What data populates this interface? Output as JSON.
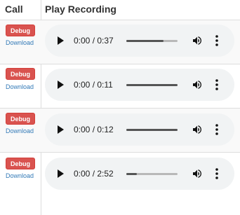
{
  "header": {
    "call": "Call",
    "play_recording": "Play Recording"
  },
  "rows": [
    {
      "debug_label": "Debug",
      "download_label": "Download",
      "time": "0:00 / 0:37",
      "buffered_fraction": 0.72
    },
    {
      "debug_label": "Debug",
      "download_label": "Download",
      "time": "0:00 / 0:11",
      "buffered_fraction": 1.0
    },
    {
      "debug_label": "Debug",
      "download_label": "Download",
      "time": "0:00 / 0:12",
      "buffered_fraction": 1.0
    },
    {
      "debug_label": "Debug",
      "download_label": "Download",
      "time": "0:00 / 2:52",
      "buffered_fraction": 0.2
    }
  ],
  "icons": {
    "play": "play-icon",
    "volume": "volume-icon",
    "menu": "more-vert-icon"
  },
  "colors": {
    "debug_bg": "#d9534f",
    "link": "#337ab7",
    "player_bg": "#f1f3f4"
  }
}
